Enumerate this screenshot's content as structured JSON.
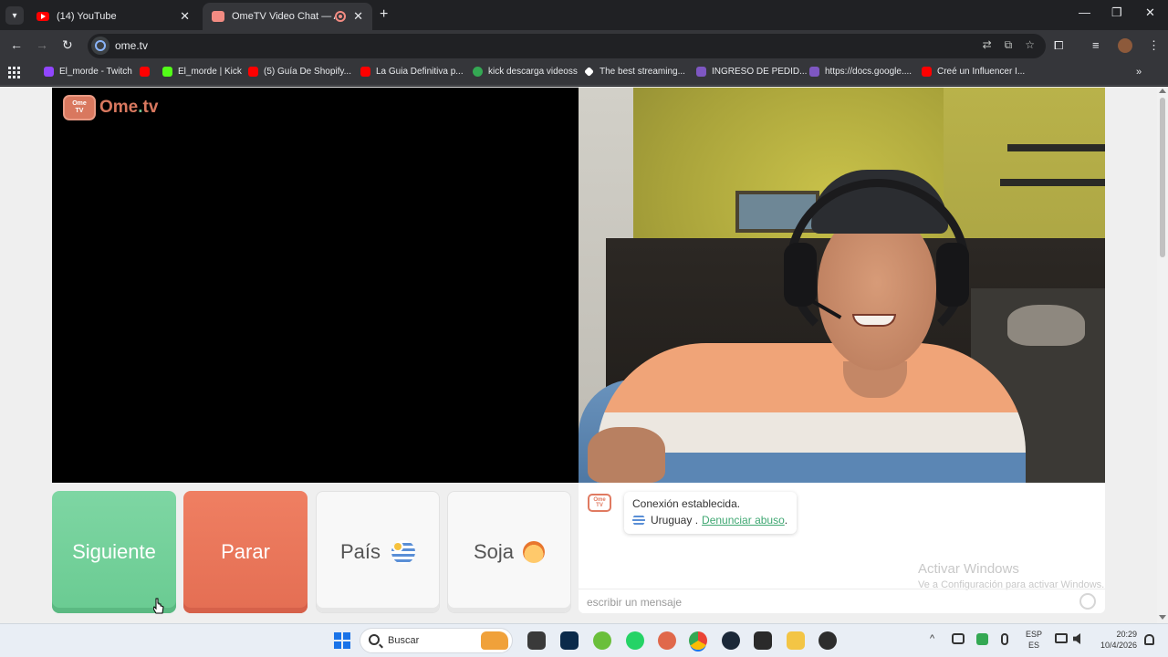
{
  "browser": {
    "tabs": [
      {
        "label": "(14) YouTube",
        "close": "✕"
      },
      {
        "label": "OmeTV Video Chat — Alter",
        "close": "✕"
      }
    ],
    "new_tab": "+",
    "window_controls": {
      "minimize": "—",
      "maximize": "❐",
      "close": "✕"
    },
    "url": "ome.tv",
    "nav": {
      "back": "←",
      "forward": "→",
      "reload": "↻"
    },
    "omnibox_icons": {
      "translate": "⇄",
      "cast": "⧉",
      "bookmark": "☆"
    },
    "toolbar_icons": {
      "extensions": "⧠",
      "media": "≡",
      "menu": "⋮"
    },
    "bookmarks": [
      {
        "label": "El_morde - Twitch",
        "icon": "twitch-icon",
        "color": "#9146ff"
      },
      {
        "label": "",
        "icon": "youtube-icon",
        "color": "#ff0000"
      },
      {
        "label": "El_morde | Kick",
        "icon": "kick-icon",
        "color": "#53fc18"
      },
      {
        "label": "(5) Guía De Shopify...",
        "icon": "youtube-icon",
        "color": "#ff0000"
      },
      {
        "label": "La Guia Definitiva p...",
        "icon": "youtube-icon",
        "color": "#ff0000"
      },
      {
        "label": "kick descarga videoss",
        "icon": "check-icon",
        "color": "#34a853"
      },
      {
        "label": "The best streaming...",
        "icon": "diamond-icon",
        "color": "#ffffff"
      },
      {
        "label": "INGRESO DE PEDID...",
        "icon": "forms-icon",
        "color": "#7e57c2"
      },
      {
        "label": "https://docs.google....",
        "icon": "forms-icon",
        "color": "#7e57c2"
      },
      {
        "label": "Creé un Influencer I...",
        "icon": "youtube-icon",
        "color": "#ff0000"
      }
    ],
    "bookmarks_more": "»"
  },
  "app": {
    "logo": {
      "badge_top": "Ome",
      "badge_bottom": "TV",
      "name_a": "Ome",
      "name_dot": ".",
      "name_b": "tv"
    },
    "buttons": {
      "next": "Siguiente",
      "stop": "Parar",
      "country": "País",
      "gender": "Soja"
    },
    "chat": {
      "logo_top": "Ome",
      "logo_bottom": "TV",
      "status": "Conexión establecida.",
      "country": "Uruguay .",
      "report_link": "Denunciar abuso",
      "report_suffix": ".",
      "input_placeholder": "escribir un mensaje"
    },
    "watermark": {
      "title": "Activar Windows",
      "subtitle": "Ve a Configuración para activar Windows."
    }
  },
  "taskbar": {
    "search_placeholder": "Buscar",
    "apps": [
      {
        "icon": "file-explorer-icon",
        "color": "#3a3a3a"
      },
      {
        "icon": "photoshop-icon",
        "color": "#0b2a4a"
      },
      {
        "icon": "gecko-icon",
        "color": "#6abf3b"
      },
      {
        "icon": "whatsapp-icon",
        "color": "#25d366"
      },
      {
        "icon": "claude-icon",
        "color": "#e0684b"
      },
      {
        "icon": "chrome-icon",
        "color": "#4285f4"
      },
      {
        "icon": "steam-icon",
        "color": "#1b2838"
      },
      {
        "icon": "epic-games-icon",
        "color": "#2a2a2a"
      },
      {
        "icon": "folder-icon",
        "color": "#f3c545"
      },
      {
        "icon": "roblox-icon",
        "color": "#2d2d2d"
      }
    ],
    "tray": {
      "chevron": "^",
      "lang_top": "ESP",
      "lang_bottom": "ES",
      "time": "20:29",
      "date": "10/4/2026"
    }
  }
}
